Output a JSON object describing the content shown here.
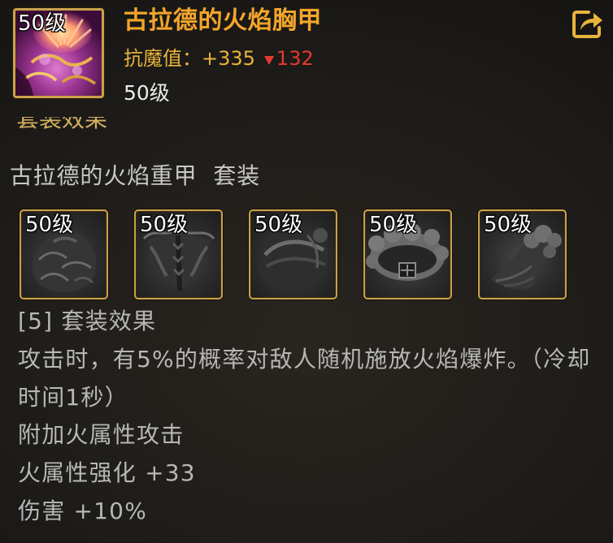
{
  "item": {
    "name": "古拉德的火焰胸甲",
    "icon": "flame-chest-armor-icon",
    "icon_level": "50级",
    "anti_magic": {
      "label": "抗魔值：",
      "value": "+335",
      "change_icon": "down-triangle-icon",
      "change": "132"
    },
    "level": "50级"
  },
  "actions": {
    "share_icon": "share-icon"
  },
  "clipped_heading": "套装效果",
  "set": {
    "name": "古拉德的火焰重甲",
    "suffix": "套装",
    "pieces": [
      {
        "level": "50级",
        "icon": "chest-armor-icon"
      },
      {
        "level": "50级",
        "icon": "pants-armor-icon"
      },
      {
        "level": "50级",
        "icon": "shoulder-armor-icon"
      },
      {
        "level": "50级",
        "icon": "belt-icon"
      },
      {
        "level": "50级",
        "icon": "shoes-icon"
      }
    ],
    "effect_header": "[5] 套装效果",
    "effect_description": "攻击时，有5%的概率对敌人随机施放火焰爆炸。（冷却时间1秒）",
    "attributes": [
      "附加火属性攻击",
      "火属性强化 +33",
      "伤害 +10%"
    ]
  },
  "colors": {
    "title": "#f3a52a",
    "stat": "#e8b43a",
    "down": "#e33a2f",
    "frame": "#c9a24c",
    "heading": "#d4b060",
    "set_name": "#c8c8c8",
    "body": "#b7b7b7"
  }
}
